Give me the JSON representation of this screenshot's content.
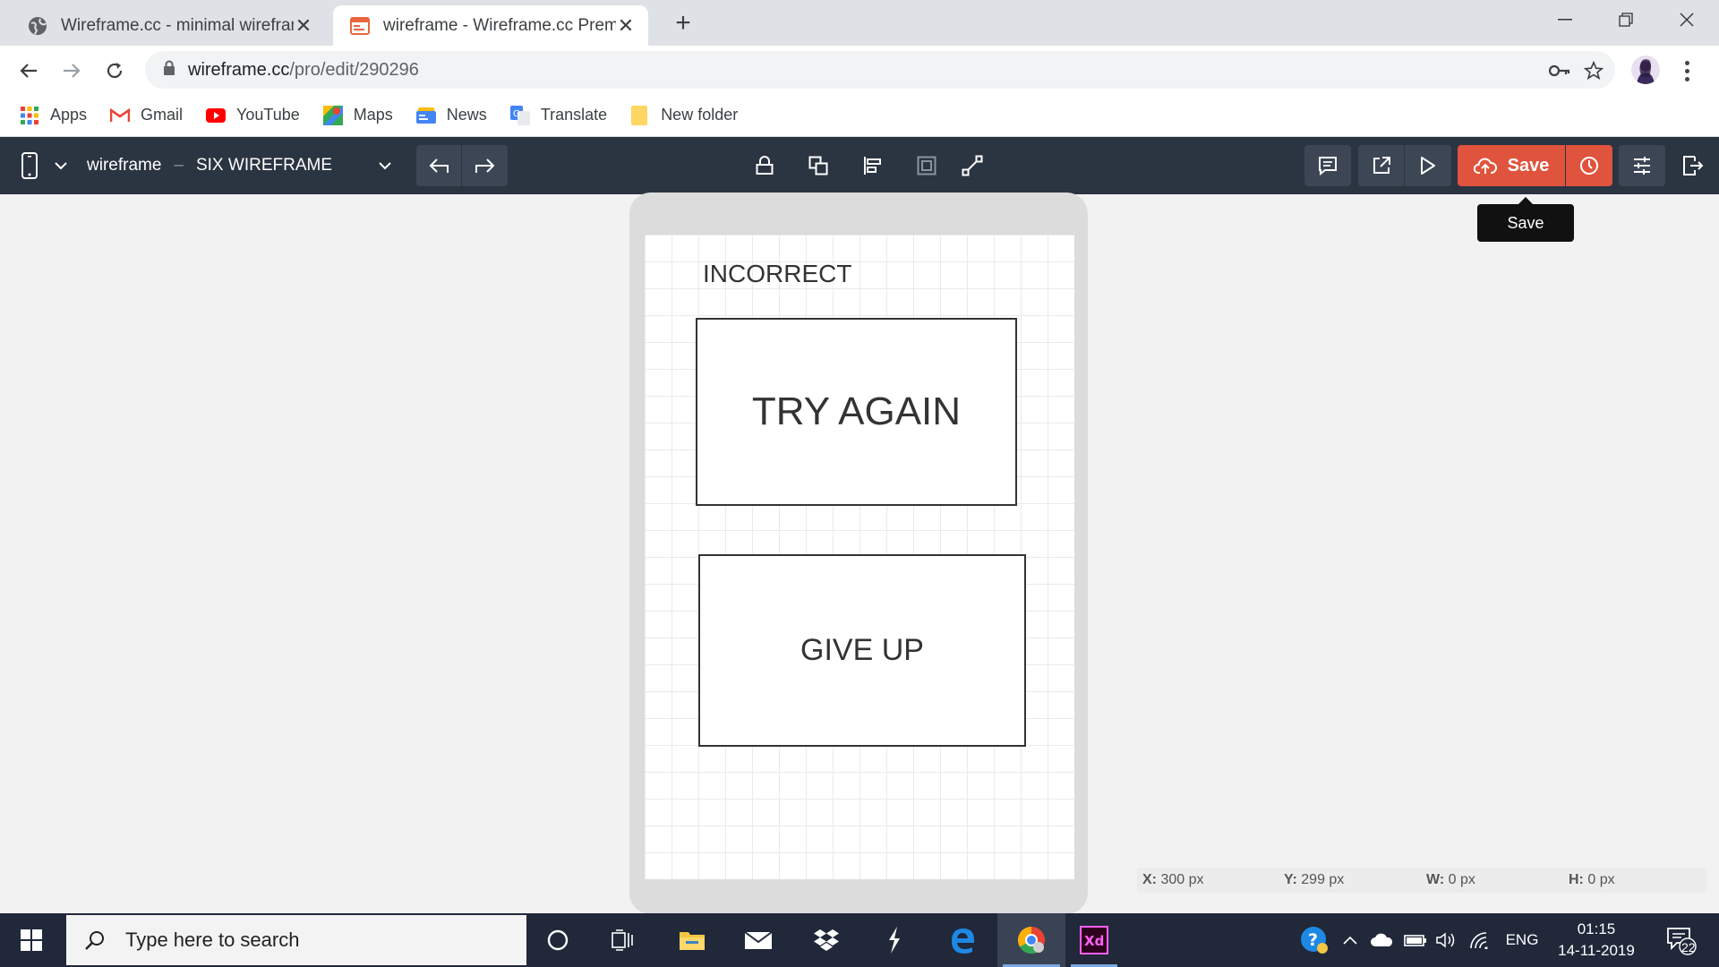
{
  "browser": {
    "tabs": [
      {
        "title": "Wireframe.cc - minimal wirefram",
        "active": false
      },
      {
        "title": "wireframe - Wireframe.cc Premiu",
        "active": true
      }
    ],
    "url_host": "wireframe.cc",
    "url_path": "/pro/edit/290296",
    "bookmarks": [
      "Apps",
      "Gmail",
      "YouTube",
      "Maps",
      "News",
      "Translate",
      "New folder"
    ]
  },
  "toolbar": {
    "project": "wireframe",
    "separator": "–",
    "page": "SIX WIREFRAME",
    "save_label": "Save",
    "tooltip": "Save",
    "colors": {
      "bar": "#2b3441",
      "save": "#e0533d"
    }
  },
  "canvas": {
    "label": "INCORRECT",
    "box1_text": "TRY AGAIN",
    "box2_text": "GIVE UP"
  },
  "coords": {
    "x_label": "X:",
    "x_value": "300 px",
    "y_label": "Y:",
    "y_value": "299 px",
    "w_label": "W:",
    "w_value": "0 px",
    "h_label": "H:",
    "h_value": "0 px"
  },
  "taskbar": {
    "search_placeholder": "Type here to search",
    "language": "ENG",
    "time": "01:15",
    "date": "14-11-2019",
    "notifications": "22"
  }
}
